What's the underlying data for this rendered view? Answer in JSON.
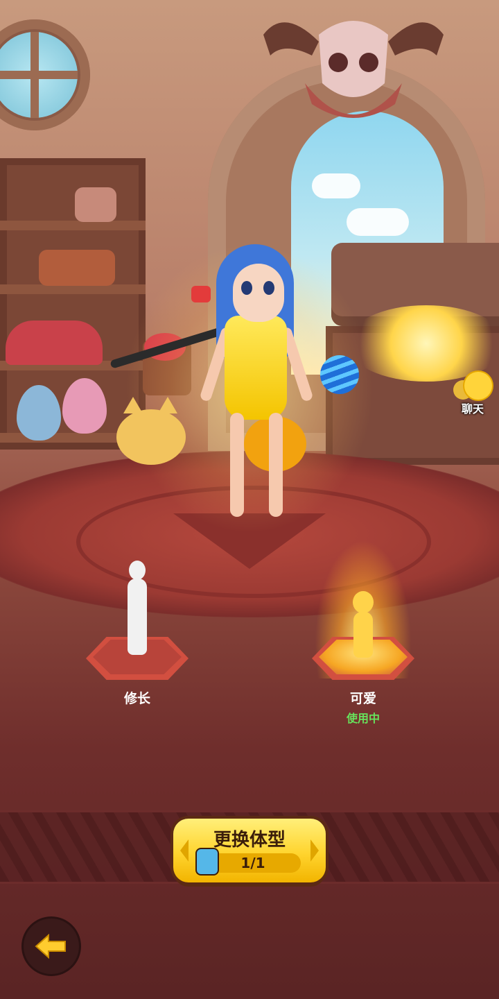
{
  "chat": {
    "label": "聊天",
    "icon": "chat-emoji-icon"
  },
  "body_types": [
    {
      "label": "修长",
      "status": "",
      "selected": false,
      "icon": "slim-figure-icon"
    },
    {
      "label": "可爱",
      "status": "使用中",
      "selected": true,
      "icon": "cute-figure-icon"
    }
  ],
  "change_button": {
    "title": "更换体型",
    "count": "1/1",
    "icon": "body-type-icon"
  },
  "back_button": {
    "icon": "back-arrow-icon"
  },
  "colors": {
    "status_green": "#67e35c",
    "button_yellow": "#ffd42e",
    "floor_red": "#9b3a33"
  }
}
